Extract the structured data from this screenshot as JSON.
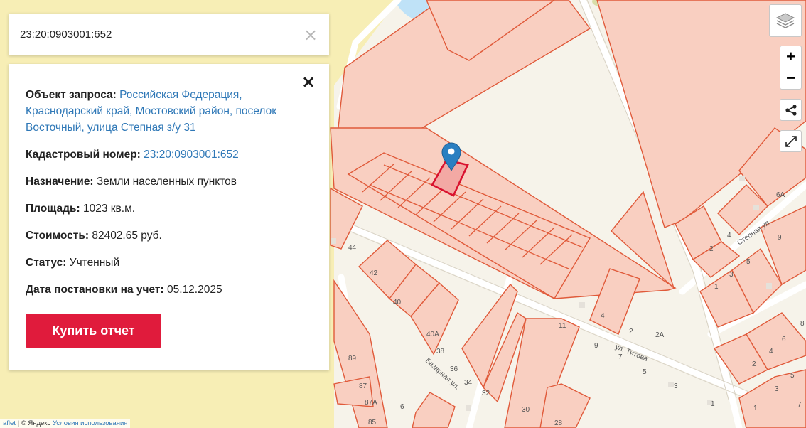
{
  "search": {
    "value": "23:20:0903001:652"
  },
  "info": {
    "request_label": "Объект запроса:",
    "request_value": "Российская Федерация, Краснодарский край, Мостовский район, поселок Восточный, улица Степная з/у 31",
    "cadastral_label": "Кадастровый номер:",
    "cadastral_value": "23:20:0903001:652",
    "purpose_label": "Назначение:",
    "purpose_value": "Земли населенных пунктов",
    "area_label": "Площадь:",
    "area_value": "1023 кв.м.",
    "cost_label": "Стоимость:",
    "cost_value": "82402.65 руб.",
    "status_label": "Статус:",
    "status_value": "Учтенный",
    "date_label": "Дата постановки на учет:",
    "date_value": "05.12.2025",
    "buy_label": "Купить отчет"
  },
  "map": {
    "streets": {
      "stepnaya": "Степная ул.",
      "titova": "ул. Титова",
      "bazarnaya": "Базарная ул."
    },
    "house_numbers": [
      "44",
      "42",
      "40",
      "40А",
      "38",
      "36",
      "34",
      "32",
      "30",
      "28",
      "89",
      "87",
      "87А",
      "85",
      "6",
      "4",
      "11",
      "9",
      "7",
      "5",
      "3",
      "2",
      "2А",
      "1",
      "6А",
      "9",
      "8",
      "2",
      "1",
      "4",
      "5",
      "3",
      "2",
      "4",
      "6",
      "1",
      "3",
      "5",
      "7"
    ],
    "icons": {
      "pin": "map-marker-icon",
      "layers": "layers-icon",
      "share": "share-icon",
      "fullscreen": "fullscreen-icon"
    }
  },
  "controls": {
    "zoom_in": "+",
    "zoom_out": "−"
  },
  "attribution": {
    "leaflet": "aflet",
    "separator": " | © Яндекс ",
    "terms": "Условия использования"
  },
  "colors": {
    "parcel_fill": "#f9cfc1",
    "parcel_stroke": "#e05a3a",
    "selected_stroke": "#d9122f",
    "marker": "#2a7fc1",
    "buy_button": "#e01b3c",
    "link": "#2f78b7"
  }
}
